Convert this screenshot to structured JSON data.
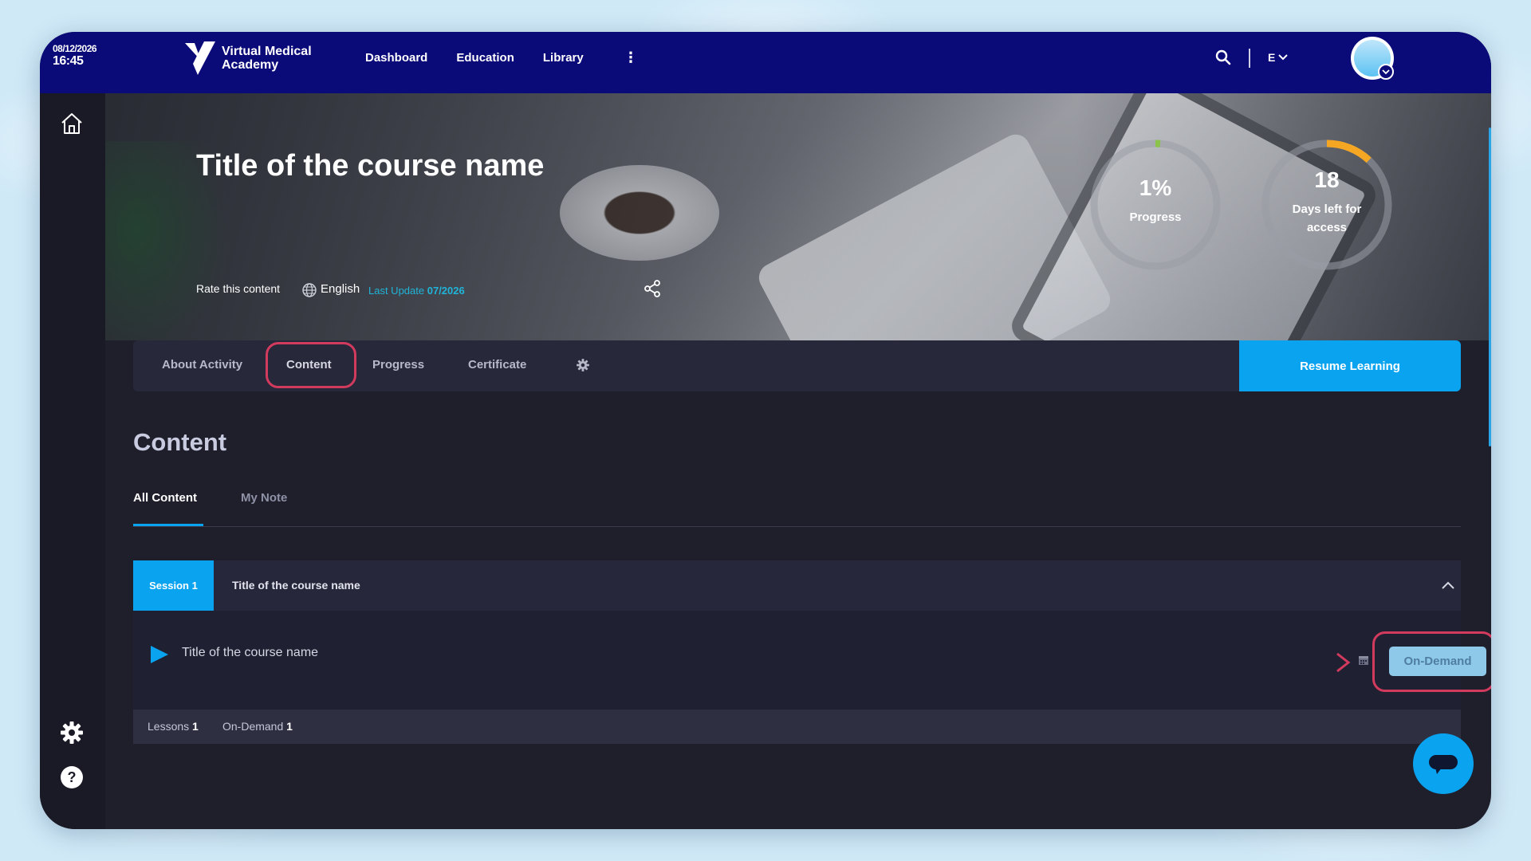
{
  "topbar": {
    "date": "08/12/2026",
    "time": "16:45",
    "logo_line1": "Virtual Medical",
    "logo_line2": "Academy",
    "nav": [
      "Dashboard",
      "Education",
      "Library"
    ],
    "language_code": "E",
    "colors": {
      "background": "#0a0a78"
    }
  },
  "hero": {
    "title": "Title of the course name",
    "rate_label": "Rate this content",
    "language": "English",
    "last_update_label": "Last Update",
    "last_update_value": "07/2026",
    "progress_value": "1%",
    "progress_label": "Progress",
    "progress_fraction": 0.01,
    "days_value": "18",
    "days_label_line1": "Days left for",
    "days_label_line2": "access",
    "days_fraction": 0.12
  },
  "tabs": {
    "items": [
      "About Activity",
      "Content",
      "Progress",
      "Certificate"
    ],
    "active": "Content",
    "resume_label": "Resume Learning"
  },
  "content": {
    "heading": "Content",
    "subtabs": [
      "All Content",
      "My Note"
    ],
    "session": {
      "badge": "Session 1",
      "title": "Title of the course name",
      "lesson_title": "Title of the course name",
      "action_label": "On-Demand",
      "footer": {
        "lessons_label": "Lessons",
        "lessons_count": "1",
        "ondemand_label": "On-Demand",
        "ondemand_count": "1"
      }
    }
  },
  "icons": {
    "home": "home-icon",
    "settings": "gear-icon",
    "help": "help-icon",
    "search": "search-icon",
    "share": "share-icon",
    "globe": "globe-icon",
    "play": "play-icon",
    "calendar": "calendar-icon",
    "chat": "chat-icon"
  },
  "colors": {
    "accent": "#09a3f0",
    "highlight": "#d23a5e",
    "progress_ring": "#8bc34a",
    "days_ring": "#f5a623"
  }
}
